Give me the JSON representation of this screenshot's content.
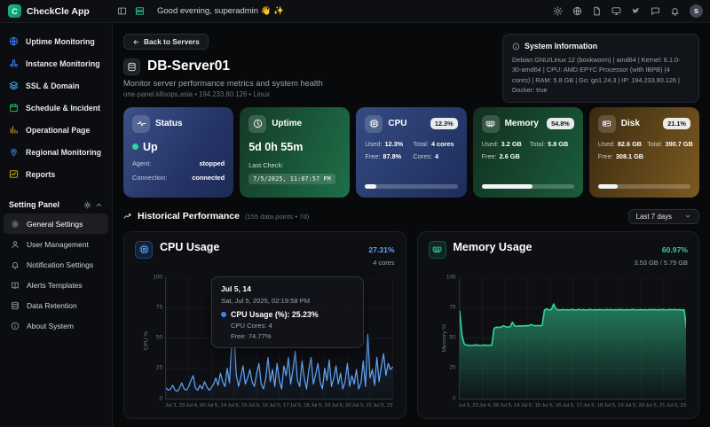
{
  "header": {
    "app_name": "CheckCle App",
    "greeting": "Good evening, superadmin 👋 ✨",
    "avatar_initial": "S",
    "action_icons": [
      "panel-toggle-icon",
      "server-icon"
    ],
    "right_icons": [
      "theme-sun-icon",
      "globe-icon",
      "docs-file-icon",
      "monitor-icon",
      "bird-icon",
      "chat-icon",
      "bell-icon"
    ]
  },
  "sidebar": {
    "items": [
      {
        "label": "Uptime Monitoring",
        "icon": "globe-icon",
        "color": "#3b82f6"
      },
      {
        "label": "Instance Monitoring",
        "icon": "cluster-icon",
        "color": "#3b82f6"
      },
      {
        "label": "SSL & Domain",
        "icon": "layers-icon",
        "color": "#38bdf8"
      },
      {
        "label": "Schedule & Incident",
        "icon": "calendar-icon",
        "color": "#22c55e"
      },
      {
        "label": "Operational Page",
        "icon": "bar-chart-icon",
        "color": "#eab308"
      },
      {
        "label": "Regional Monitoring",
        "icon": "map-pin-icon",
        "color": "#3b82f6"
      },
      {
        "label": "Reports",
        "icon": "report-chart-icon",
        "color": "#eab308"
      }
    ],
    "section_label": "Setting Panel",
    "settings_items": [
      {
        "label": "General Settings",
        "icon": "gear-icon",
        "active": true
      },
      {
        "label": "User Management",
        "icon": "user-icon",
        "active": false
      },
      {
        "label": "Notification Settings",
        "icon": "bell-icon",
        "active": false
      },
      {
        "label": "Alerts Templates",
        "icon": "book-icon",
        "active": false
      },
      {
        "label": "Data Retention",
        "icon": "database-icon",
        "active": false
      },
      {
        "label": "About System",
        "icon": "info-icon",
        "active": false
      }
    ]
  },
  "page": {
    "back_button": "Back to Servers",
    "title": "DB-Server01",
    "subtitle": "Monitor server performance metrics and system health",
    "meta": "one-panel.k8sops.asia • 194.233.80.126 • Linux"
  },
  "system_info": {
    "title": "System Information",
    "details": "Debian GNU/Linux 12 (bookworm) | amd64 | Kernel: 6.1.0-30-amd64 | CPU: AMD EPYC Processor (with IBPB) (4 cores) | RAM: 5.8 GB | Go: go1.24.3 | IP: 194.233.80.126 | Docker: true"
  },
  "cards": {
    "status": {
      "title": "Status",
      "state": "Up",
      "agent_label": "Agent:",
      "agent_value": "stopped",
      "connection_label": "Connection:",
      "connection_value": "connected"
    },
    "uptime": {
      "title": "Uptime",
      "value": "5d 0h 55m",
      "last_check_label": "Last Check:",
      "last_check_value": "7/5/2025, 11:07:57 PM"
    },
    "cpu": {
      "title": "CPU",
      "badge": "12.3%",
      "used_label": "Used:",
      "used": "12.3%",
      "total_label": "Total:",
      "total": "4 cores",
      "free_label": "Free:",
      "free": "87.8%",
      "cores_label": "Cores:",
      "cores": "4",
      "progress_pct": 12.3
    },
    "memory": {
      "title": "Memory",
      "badge": "54.8%",
      "used_label": "Used:",
      "used": "3.2 GB",
      "total_label": "Total:",
      "total": "5.8 GB",
      "free_label": "Free:",
      "free": "2.6 GB",
      "progress_pct": 54.8
    },
    "disk": {
      "title": "Disk",
      "badge": "21.1%",
      "used_label": "Used:",
      "used": "82.6 GB",
      "total_label": "Total:",
      "total": "390.7 GB",
      "free_label": "Free:",
      "free": "308.1 GB",
      "progress_pct": 21.1
    }
  },
  "history": {
    "title": "Historical Performance",
    "meta": "(155 data points • 7d)",
    "range_selector": "Last 7 days"
  },
  "tooltip": {
    "title": "Jul 5, 14",
    "timestamp": "Sat, Jul 5, 2025, 02:19:58 PM",
    "main": "CPU Usage (%): 25.23%",
    "line2": "CPU Cores: 4",
    "line3": "Free: 74.77%"
  },
  "chart_data": [
    {
      "type": "line",
      "title": "CPU Usage",
      "current_value": "27.31%",
      "subtitle": "4 cores",
      "ylabel": "CPU %",
      "yticks": [
        100,
        75,
        50,
        25,
        0
      ],
      "ylim": [
        0,
        100
      ],
      "grid": true,
      "color": "#60a5fa",
      "x_labels": [
        "Jul 3, 23",
        "Jul 4, 00",
        "Jul 5, 14",
        "Jul 5, 15",
        "Jul 5, 16",
        "Jul 5, 17",
        "Jul 5, 18",
        "Jul 5, 19",
        "Jul 5, 20",
        "Jul 5, 21",
        "Jul 5, 23"
      ],
      "values": [
        9,
        7,
        8,
        11,
        7,
        6,
        9,
        13,
        8,
        7,
        10,
        15,
        19,
        9,
        7,
        11,
        8,
        14,
        10,
        7,
        9,
        12,
        17,
        11,
        21,
        14,
        10,
        25,
        13,
        46,
        55,
        20,
        10,
        18,
        27,
        12,
        17,
        24,
        14,
        10,
        21,
        29,
        12,
        8,
        17,
        34,
        14,
        24,
        10,
        29,
        15,
        8,
        27,
        19,
        34,
        12,
        24,
        39,
        15,
        10,
        31,
        17,
        8,
        24,
        34,
        12,
        20,
        29,
        14,
        8,
        25,
        15,
        32,
        10,
        17,
        27,
        12,
        21,
        8,
        14,
        29,
        10,
        19,
        12,
        24,
        8,
        13,
        31,
        10,
        53,
        17,
        24,
        11,
        34,
        14,
        27,
        37,
        19,
        29,
        24,
        26
      ]
    },
    {
      "type": "area",
      "title": "Memory Usage",
      "current_value": "60.97%",
      "subtitle": "3.53 GB / 5.79 GB",
      "ylabel": "Memory %",
      "yticks": [
        100,
        75,
        50,
        25,
        0
      ],
      "ylim": [
        0,
        100
      ],
      "grid": true,
      "color": "#34d399",
      "x_labels": [
        "Jul 3, 23",
        "Jul 4, 00",
        "Jul 5, 14",
        "Jul 5, 15",
        "Jul 5, 16",
        "Jul 5, 17",
        "Jul 5, 18",
        "Jul 5, 19",
        "Jul 5, 20",
        "Jul 5, 21",
        "Jul 5, 23"
      ],
      "values": [
        72,
        52,
        45,
        44,
        44,
        43.7,
        44,
        44.3,
        44,
        43.8,
        44,
        44.1,
        43.9,
        44,
        44,
        58,
        59,
        58.6,
        59,
        60,
        59.4,
        59,
        59.2,
        63,
        60,
        59.6,
        60,
        59.8,
        60,
        60.2,
        60,
        61,
        60.4,
        60,
        60.3,
        60.1,
        60.4,
        73,
        74,
        73,
        73.5,
        78,
        74,
        73.2,
        73,
        73.4,
        73.1,
        73.3,
        73,
        73.5,
        73.2,
        73,
        73.6,
        73.1,
        73.4,
        73,
        73.2,
        73.5,
        73,
        73.3,
        73.1,
        73.4,
        73.2,
        73,
        73.5,
        73.2,
        73.4,
        73,
        73.3,
        73.1,
        73.5,
        73.2,
        73,
        73.4,
        73.1,
        73.3,
        73.5,
        73,
        73.2,
        73.4,
        73.1,
        73.3,
        73,
        73.5,
        73.2,
        73.4,
        73.1,
        73.3,
        73.2,
        73.5,
        73,
        73.3,
        73.4,
        73.2,
        73.5,
        73.1,
        73.4,
        73,
        73.2,
        58
      ]
    }
  ]
}
